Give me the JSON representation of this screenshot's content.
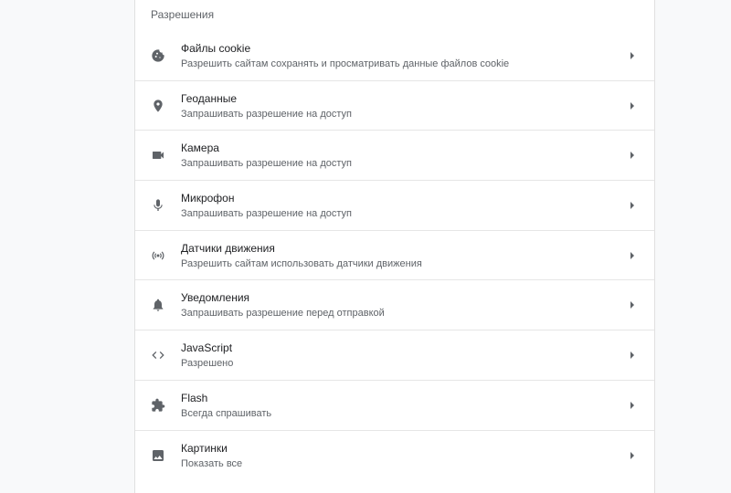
{
  "section": {
    "title": "Разрешения"
  },
  "rows": [
    {
      "label": "Файлы cookie",
      "sublabel": "Разрешить сайтам сохранять и просматривать данные файлов cookie",
      "icon": "cookie-icon"
    },
    {
      "label": "Геоданные",
      "sublabel": "Запрашивать разрешение на доступ",
      "icon": "location-pin-icon"
    },
    {
      "label": "Камера",
      "sublabel": "Запрашивать разрешение на доступ",
      "icon": "camera-icon"
    },
    {
      "label": "Микрофон",
      "sublabel": "Запрашивать разрешение на доступ",
      "icon": "microphone-icon"
    },
    {
      "label": "Датчики движения",
      "sublabel": "Разрешить сайтам использовать датчики движения",
      "icon": "motion-sensors-icon"
    },
    {
      "label": "Уведомления",
      "sublabel": "Запрашивать разрешение перед отправкой",
      "icon": "bell-icon"
    },
    {
      "label": "JavaScript",
      "sublabel": "Разрешено",
      "icon": "code-icon"
    },
    {
      "label": "Flash",
      "sublabel": "Всегда спрашивать",
      "icon": "puzzle-icon"
    },
    {
      "label": "Картинки",
      "sublabel": "Показать все",
      "icon": "image-icon"
    }
  ],
  "colors": {
    "background": "#f8f9fa",
    "card": "#ffffff",
    "icon": "#5f6368",
    "text_primary": "#202124",
    "text_secondary": "#5f6368"
  }
}
